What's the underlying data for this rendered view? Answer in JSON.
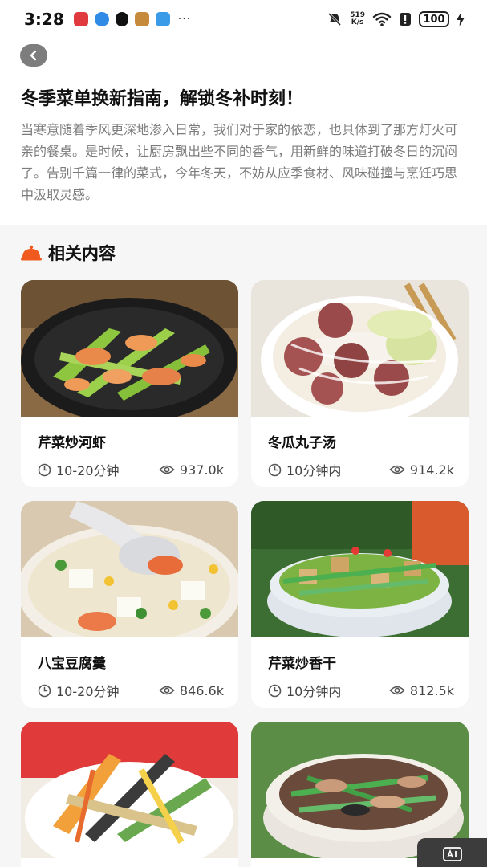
{
  "status_bar": {
    "time": "3:28",
    "net_speed_value": "519",
    "net_speed_unit": "K/s",
    "battery": "100",
    "more_dots": "···"
  },
  "article": {
    "title": "冬季菜单换新指南，解锁冬补时刻！",
    "description": "当寒意随着季风更深地渗入日常，我们对于家的依恋，也具体到了那方灯火可亲的餐桌。是时候，让厨房飘出些不同的香气，用新鲜的味道打破冬日的沉闷了。告别千篇一律的菜式，今年冬天，不妨从应季食材、风味碰撞与烹饪巧思中汲取灵感。"
  },
  "related": {
    "heading": "相关内容",
    "accent_color": "#f05a1e",
    "items": [
      {
        "name": "芹菜炒河虾",
        "time": "10-20分钟",
        "views": "937.0k"
      },
      {
        "name": "冬瓜丸子汤",
        "time": "10分钟内",
        "views": "914.2k"
      },
      {
        "name": "八宝豆腐羹",
        "time": "10-20分钟",
        "views": "846.6k"
      },
      {
        "name": "芹菜炒香干",
        "time": "10分钟内",
        "views": "812.5k"
      },
      {
        "name": "",
        "time": "",
        "views": ""
      },
      {
        "name": "",
        "time": "",
        "views": ""
      }
    ]
  },
  "icons": {
    "back": "chevron-left-icon",
    "clock": "clock-icon",
    "views": "eye-icon",
    "heading": "cloche-icon"
  }
}
